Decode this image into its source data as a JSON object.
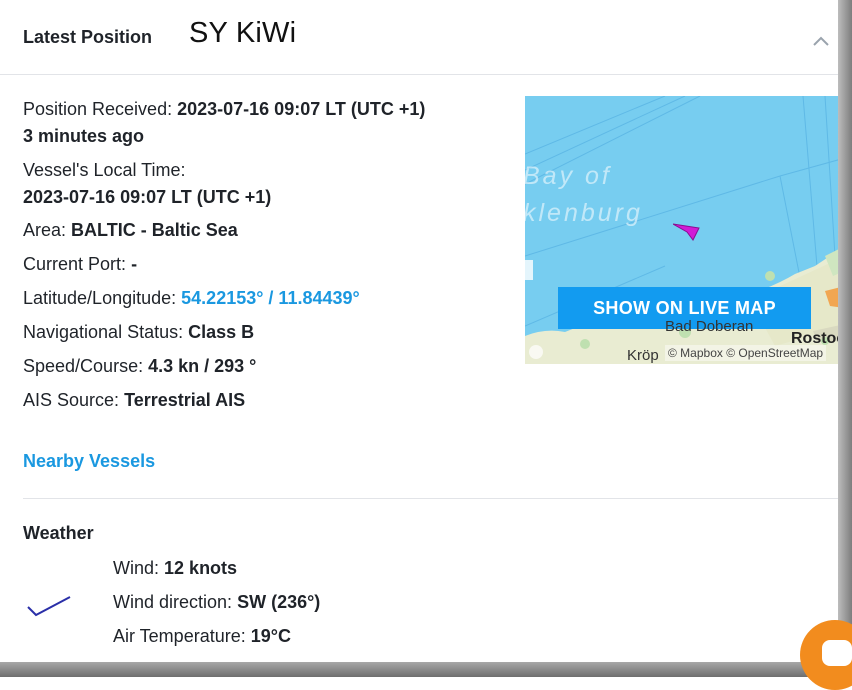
{
  "header": {
    "title": "Latest Position",
    "vessel_name": "SY KiWi",
    "collapse_icon": "chevron-up-icon"
  },
  "position": {
    "received_label": "Position Received:",
    "received_value": "2023-07-16 09:07 LT (UTC +1)",
    "received_ago": "3 minutes ago",
    "local_time_label": "Vessel's Local Time:",
    "local_time_value": "2023-07-16 09:07 LT (UTC +1)",
    "area_label": "Area:",
    "area_value": "BALTIC - Baltic Sea",
    "port_label": "Current Port:",
    "port_value": "-",
    "latlon_label": "Latitude/Longitude:",
    "latlon_value": "54.22153° / 11.84439°",
    "nav_status_label": "Navigational Status:",
    "nav_status_value": "Class B",
    "speed_course_label": "Speed/Course:",
    "speed_course_value": "4.3 kn / 293 °",
    "ais_source_label": "AIS Source:",
    "ais_source_value": "Terrestrial AIS"
  },
  "map": {
    "button_label": "SHOW ON LIVE MAP",
    "place_line1": "Bay of",
    "place_line2": "klenburg",
    "town_1": "Bad Doberan",
    "town_2": "Rostoc",
    "town_3": "Kröp",
    "credit": "© Mapbox © OpenStreetMap",
    "water_color": "#77cdf0",
    "vessel_marker_color": "#d01bd6"
  },
  "nearby": {
    "label": "Nearby Vessels"
  },
  "weather": {
    "title": "Weather",
    "wind_label": "Wind:",
    "wind_value": "12 knots",
    "direction_label": "Wind direction:",
    "direction_value": "SW (236°)",
    "temp_label": "Air Temperature:",
    "temp_value": "19°C",
    "wind_icon": "wind-direction-icon"
  },
  "colors": {
    "accent": "#1a98e0",
    "button": "#129bf0",
    "chat": "#f28c1e"
  }
}
